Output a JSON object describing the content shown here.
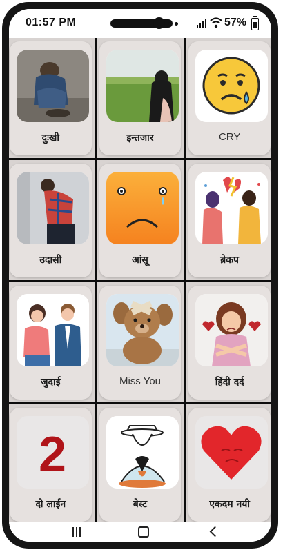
{
  "status": {
    "time": "01:57 PM",
    "battery": "57%"
  },
  "items": [
    {
      "label": "दुःखी",
      "icon": "sad-boy-sitting-photo"
    },
    {
      "label": "इन्तजार",
      "icon": "girl-waiting-field-photo"
    },
    {
      "label": "CRY",
      "icon": "crying-emoji-icon"
    },
    {
      "label": "उदासी",
      "icon": "sad-man-wall-photo"
    },
    {
      "label": "आंसू",
      "icon": "teardrop-emoji-icon"
    },
    {
      "label": "ब्रेकप",
      "icon": "breakup-couple-illustration"
    },
    {
      "label": "जुदाई",
      "icon": "separation-couple-illustration"
    },
    {
      "label": "Miss You",
      "icon": "teddy-bear-bandage-photo"
    },
    {
      "label": "हिंदी दर्द",
      "icon": "heartbroken-girl-illustration"
    },
    {
      "label": "दो लाईन",
      "icon": "number-two-icon"
    },
    {
      "label": "बेस्ट",
      "icon": "man-broken-heart-illustration"
    },
    {
      "label": "एकदम नयी",
      "icon": "sad-heart-icon"
    }
  ],
  "colors": {
    "accent_red": "#b01419",
    "emoji_yellow": "#f7c83a",
    "emoji_orange": "#f79a1f",
    "heart_red": "#e2262b"
  }
}
